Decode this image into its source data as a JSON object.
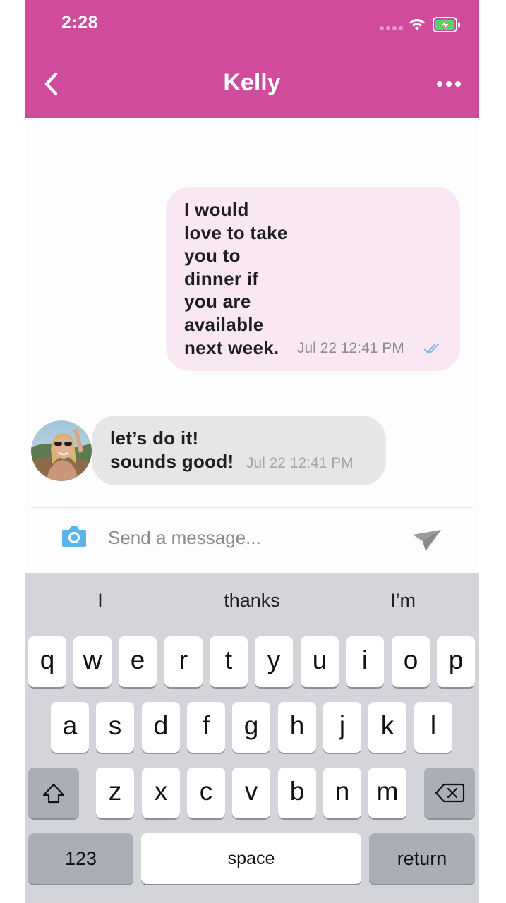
{
  "status_bar": {
    "time": "2:28",
    "icons": [
      "signal-icon",
      "wifi-icon",
      "battery-charging-icon"
    ]
  },
  "header": {
    "title": "Kelly",
    "back_icon": "chevron-left-icon",
    "menu_icon": "more-horizontal-icon",
    "background_color": "#d14b9c"
  },
  "messages": [
    {
      "direction": "outgoing",
      "text": "I would\nlove to take\nyou to\ndinner if\nyou are\navailable\nnext week.",
      "time": "Jul 22 12:41 PM",
      "status_icon": "double-check-icon",
      "bubble_color": "#f9e7f3"
    },
    {
      "direction": "incoming",
      "text": "let’s do it!\nsounds good!",
      "time": "Jul 22 12:41 PM",
      "avatar_icon": "contact-avatar",
      "bubble_color": "#e6e6e6"
    }
  ],
  "composer": {
    "placeholder": "Send a message...",
    "camera_icon": "camera-icon",
    "send_icon": "send-icon"
  },
  "keyboard": {
    "suggestions": [
      "I",
      "thanks",
      "I’m"
    ],
    "row1": [
      "q",
      "w",
      "e",
      "r",
      "t",
      "y",
      "u",
      "i",
      "o",
      "p"
    ],
    "row2": [
      "a",
      "s",
      "d",
      "f",
      "g",
      "h",
      "j",
      "k",
      "l"
    ],
    "row3": [
      "z",
      "x",
      "c",
      "v",
      "b",
      "n",
      "m"
    ],
    "shift_icon": "shift-icon",
    "delete_icon": "backspace-icon",
    "numbers_label": "123",
    "space_label": "space",
    "return_label": "return"
  }
}
